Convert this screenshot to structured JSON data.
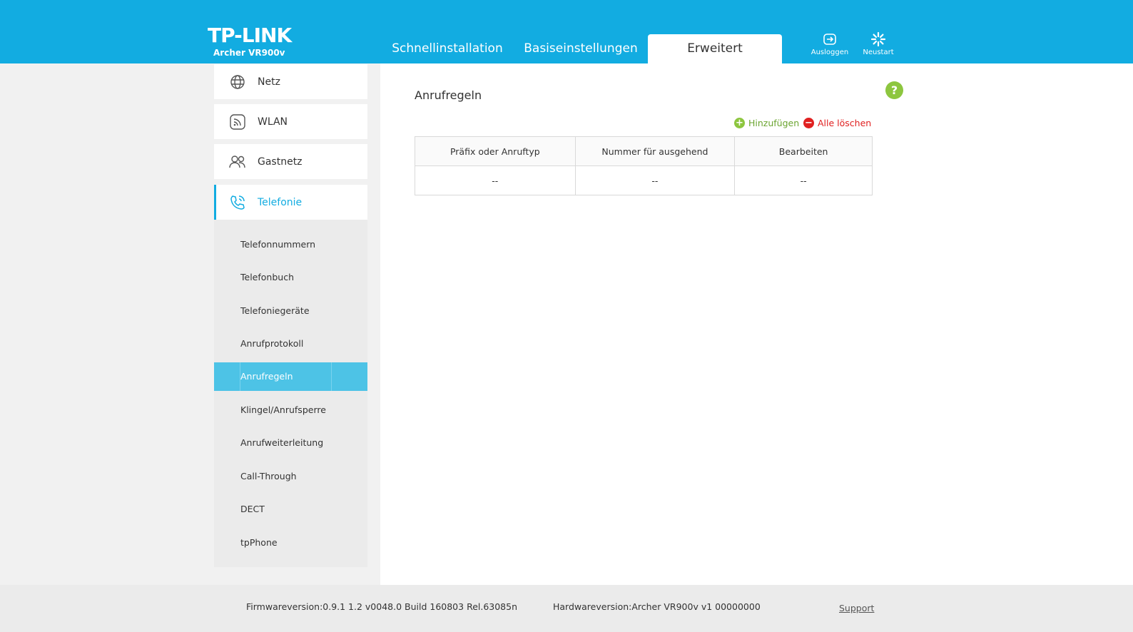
{
  "header": {
    "brand": "TP-LINK",
    "model": "Archer VR900v",
    "tabs": [
      {
        "label": "Schnellinstallation"
      },
      {
        "label": "Basiseinstellungen"
      },
      {
        "label": "Erweitert"
      }
    ],
    "logout_label": "Ausloggen",
    "reboot_label": "Neustart"
  },
  "sidebar": {
    "items": [
      {
        "label": "Netz",
        "icon": "globe-icon"
      },
      {
        "label": "WLAN",
        "icon": "wifi-icon"
      },
      {
        "label": "Gastnetz",
        "icon": "guest-users-icon"
      },
      {
        "label": "Telefonie",
        "icon": "phone-icon"
      }
    ],
    "submenu": [
      {
        "label": "Telefonnummern"
      },
      {
        "label": "Telefonbuch"
      },
      {
        "label": "Telefoniegeräte"
      },
      {
        "label": "Anrufprotokoll"
      },
      {
        "label": "Anrufregeln"
      },
      {
        "label": "Klingel/Anrufsperre"
      },
      {
        "label": "Anrufweiterleitung"
      },
      {
        "label": "Call-Through"
      },
      {
        "label": "DECT"
      },
      {
        "label": "tpPhone"
      }
    ]
  },
  "main": {
    "title": "Anrufregeln",
    "help": "?",
    "add_label": "Hinzufügen",
    "delete_all_label": "Alle löschen",
    "table": {
      "headers": [
        "Präfix oder Anruftyp",
        "Nummer für ausgehend",
        "Bearbeiten"
      ],
      "rows": [
        [
          "--",
          "--",
          "--"
        ]
      ]
    }
  },
  "footer": {
    "firmware": "Firmwareversion:0.9.1 1.2 v0048.0 Build 160803 Rel.63085n",
    "hardware": "Hardwareversion:Archer VR900v v1 00000000",
    "support": "Support"
  },
  "colors": {
    "brand_blue": "#12ace1",
    "active_sub": "#4dc3e6",
    "add_green": "#8dc63f",
    "delete_red": "#e02020"
  }
}
